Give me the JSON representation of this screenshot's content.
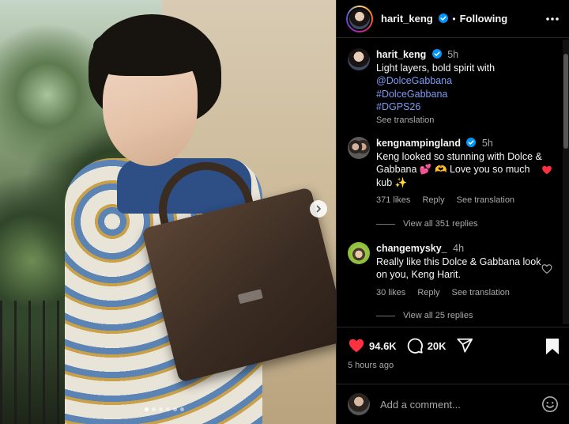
{
  "post": {
    "username": "harit_keng",
    "separator": "•",
    "follow_state": "Following",
    "caption_time": "5h",
    "caption_text": "Light layers, bold spirit with",
    "caption_links": [
      "@DolceGabbana",
      "#DolceGabbana",
      "#DGPS26"
    ],
    "see_translation": "See translation"
  },
  "comments": [
    {
      "username": "kengnampingland",
      "time": "5h",
      "text": "Keng looked so stunning with Dolce & Gabbana 💕 🫶 Love you so much kub ✨",
      "likes": "371 likes",
      "reply": "Reply",
      "see_translation": "See translation",
      "view_replies": "View all 351 replies",
      "liked": true
    },
    {
      "username": "changemysky_",
      "time": "4h",
      "text": "Really like this Dolce & Gabbana look on you, Keng Harit.",
      "likes": "30 likes",
      "reply": "Reply",
      "see_translation": "See translation",
      "view_replies": "View all 25 replies",
      "liked": false
    }
  ],
  "actions": {
    "likes": "94.6K",
    "comments": "20K",
    "time_ago": "5 hours ago"
  },
  "add_comment": {
    "placeholder": "Add a comment..."
  },
  "carousel": {
    "total": 6,
    "active": 1
  },
  "colors": {
    "liked": "#ff3040",
    "link": "#7e9cf5",
    "verified": "#0095f6"
  },
  "icons": {
    "next": "chevron-right-icon",
    "more": "more-horizontal-icon",
    "like": "heart-icon",
    "comment": "comment-icon",
    "share": "share-icon",
    "save": "bookmark-icon",
    "emoji": "emoji-icon",
    "verified": "verified-badge-icon"
  }
}
